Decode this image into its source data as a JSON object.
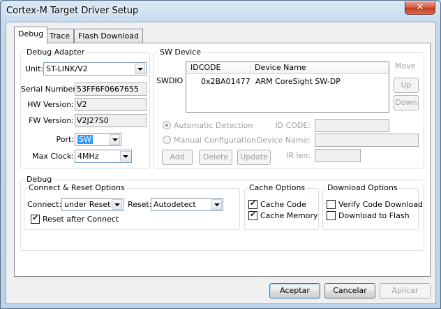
{
  "window": {
    "title": "Cortex-M Target Driver Setup",
    "close_glyph": "✕"
  },
  "tabs": [
    {
      "label": "Debug"
    },
    {
      "label": "Trace"
    },
    {
      "label": "Flash Download"
    }
  ],
  "debug_adapter": {
    "title": "Debug Adapter",
    "unit_label": "Unit:",
    "unit_value": "ST-LINK/V2",
    "serial_label": "Serial Number:",
    "serial_value": "53FF6F0667655",
    "hw_label": "HW Version:",
    "hw_value": "V2",
    "fw_label": "FW Version:",
    "fw_value": "V2J27S0",
    "port_label": "Port:",
    "port_value": "SW",
    "clock_label": "Max Clock:",
    "clock_value": "4MHz"
  },
  "sw_device": {
    "title": "SW Device",
    "move_label": "Move",
    "swdio_label": "SWDIO",
    "columns": [
      "IDCODE",
      "Device Name"
    ],
    "rows": [
      {
        "idcode": "0x2BA01477",
        "name": "ARM CoreSight SW-DP"
      }
    ],
    "up_label": "Up",
    "down_label": "Down",
    "auto_detect_label": "Automatic Detection",
    "manual_config_label": "Manual Configuration",
    "id_code_label": "ID CODE:",
    "device_name_label": "Device Name:",
    "ir_len_label": "IR len:",
    "add_label": "Add",
    "delete_label": "Delete",
    "update_label": "Update"
  },
  "debug": {
    "title": "Debug",
    "connect_reset": {
      "title": "Connect & Reset Options",
      "connect_label": "Connect:",
      "connect_value": "under Reset",
      "reset_label": "Reset:",
      "reset_value": "Autodetect",
      "reset_after_connect": "Reset after Connect",
      "reset_after_connect_checked": true
    },
    "cache": {
      "title": "Cache Options",
      "code_label": "Cache Code",
      "code_checked": true,
      "memory_label": "Cache Memory",
      "memory_checked": true
    },
    "download": {
      "title": "Download Options",
      "verify_label": "Verify Code Download",
      "verify_checked": false,
      "flash_label": "Download to Flash",
      "flash_checked": false
    }
  },
  "footer": {
    "ok_label": "Aceptar",
    "cancel_label": "Cancelar",
    "apply_label": "Aplicar"
  },
  "colors": {
    "selection": "#3399ff",
    "title_bar": "#bcd3ea",
    "close_button": "#c03a20"
  }
}
